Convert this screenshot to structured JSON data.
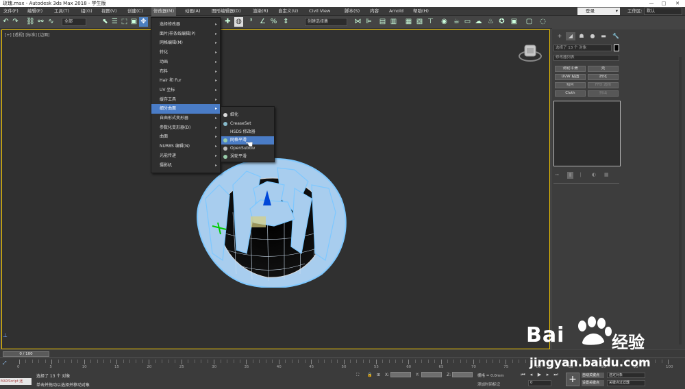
{
  "window": {
    "title": "玫瑰.max - Autodesk 3ds Max 2018  - 学生版",
    "min": "—",
    "max": "□",
    "close": "✕"
  },
  "menubar": {
    "items": [
      "文件(F)",
      "编辑(E)",
      "工具(T)",
      "组(G)",
      "视图(V)",
      "创建(C)",
      "修改器(M)",
      "动画(A)",
      "图形编辑器(D)",
      "渲染(R)",
      "自定义(U)",
      "Civil View",
      "脚本(S)",
      "内容",
      "Arnold",
      "帮助(H)"
    ],
    "login": "登录",
    "workspace_label": "工作区:",
    "workspace_value": "默认"
  },
  "toolbar": {
    "selection_filter": "全部",
    "named_selection": "创建选择集"
  },
  "viewport": {
    "label": "[+] [透视] [标准] [边面]"
  },
  "modifiers_menu": {
    "items": [
      {
        "label": "选择修改器",
        "sub": true
      },
      {
        "label": "面片/样条线编辑(P)",
        "sub": true
      },
      {
        "label": "网格编辑(M)",
        "sub": true
      },
      {
        "label": "转化",
        "sub": true
      },
      {
        "label": "动画",
        "sub": true
      },
      {
        "label": "布料",
        "sub": true
      },
      {
        "label": "Hair 和 Fur",
        "sub": true
      },
      {
        "label": "UV 坐标",
        "sub": true
      },
      {
        "label": "缓存工具",
        "sub": true
      },
      {
        "label": "细分曲面",
        "sub": true,
        "active": true
      },
      {
        "label": "自由形式变形器",
        "sub": true
      },
      {
        "label": "参数化变形器(D)",
        "sub": true
      },
      {
        "label": "曲面",
        "sub": true
      },
      {
        "label": "NURBS 编辑(N)",
        "sub": true
      },
      {
        "label": "光能传递",
        "sub": true
      },
      {
        "label": "摄影机",
        "sub": true
      }
    ]
  },
  "subdivision_menu": {
    "items": [
      {
        "label": "细化",
        "icon": "refine-icon"
      },
      {
        "label": "CreaseSet",
        "icon": "creaseset-icon"
      },
      {
        "label": "HSDS 修改器",
        "icon": "hsds-icon"
      },
      {
        "label": "网格平滑",
        "icon": "meshsmooth-icon",
        "active": true
      },
      {
        "label": "OpenSubdiv",
        "icon": "opensubdiv-icon"
      },
      {
        "label": "涡轮平滑",
        "icon": "turbosmooth-icon"
      }
    ]
  },
  "command_panel": {
    "object_name": "选择了 13 个 对象",
    "modifier_list": "修改器列表",
    "buttons": [
      {
        "label": "涡轮平滑",
        "dim": false
      },
      {
        "label": "壳",
        "dim": false
      },
      {
        "label": "UVW 贴图",
        "dim": false
      },
      {
        "label": "挤化",
        "dim": false
      },
      {
        "label": "切片",
        "dim": false
      },
      {
        "label": "FFD 选择",
        "dim": true
      },
      {
        "label": "Cloth",
        "dim": false
      },
      {
        "label": "挤出",
        "dim": true
      }
    ],
    "colors": {
      "swatch": "#000000"
    }
  },
  "timeline": {
    "slider": "0 / 100",
    "ticks": [
      "0",
      "5",
      "10",
      "15",
      "20",
      "25",
      "30",
      "35",
      "40",
      "45",
      "50",
      "55",
      "60",
      "65",
      "70",
      "75",
      "80",
      "85",
      "90",
      "95",
      "100"
    ]
  },
  "status": {
    "maxscript": "MAXScript 迷",
    "line1": "选择了 13 个 对象",
    "line2": "单击并拖动以选择并移动对象",
    "x_label": "X:",
    "y_label": "Y:",
    "z_label": "Z:",
    "grid": "栅格 = 0.0mm",
    "add_time_tag": "添加时间标记",
    "frame": "0",
    "auto_key": "自动关键点",
    "set_key": "设置关键点",
    "selected_object": "选定对象",
    "key_filter": "关键点过滤器"
  },
  "watermark": {
    "brand": "Bai",
    "brand2": "经验",
    "url": "jingyan.baidu.com"
  }
}
